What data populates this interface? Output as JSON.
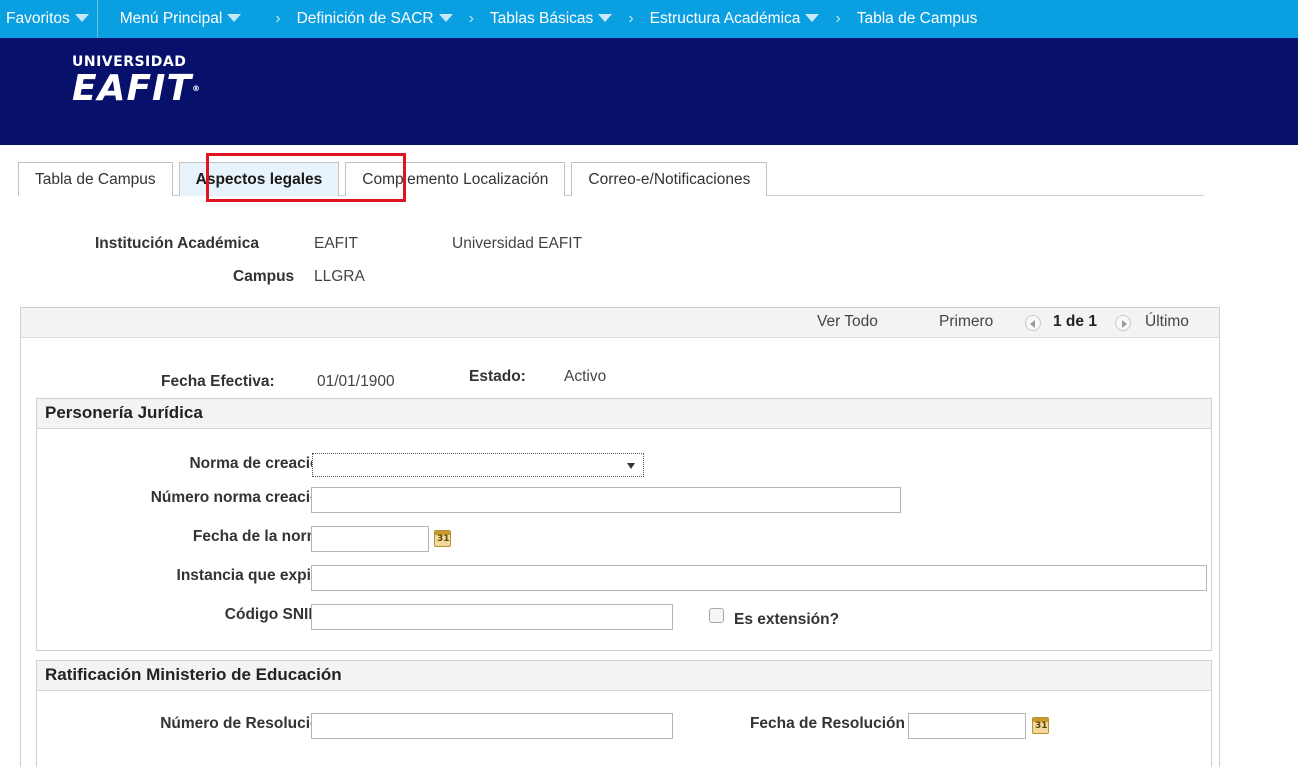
{
  "nav": {
    "favoritos": "Favoritos",
    "menu_principal": "Menú Principal",
    "breadcrumb": [
      "Definición de SACR",
      "Tablas Básicas",
      "Estructura Académica",
      "Tabla de Campus"
    ]
  },
  "banner": {
    "logo_line1": "UNIVERSIDAD",
    "logo_line2": "EAFIT",
    "logo_reg": "®"
  },
  "tabs": [
    {
      "label": "Tabla de Campus",
      "active": false
    },
    {
      "label": "Aspectos legales",
      "active": true
    },
    {
      "label": "Complemento Localización",
      "active": false
    },
    {
      "label": "Correo-e/Notificaciones",
      "active": false
    }
  ],
  "header": {
    "institucion_label": "Institución Académica",
    "institucion_code": "EAFIT",
    "institucion_name": "Universidad EAFIT",
    "campus_label": "Campus",
    "campus_value": "LLGRA"
  },
  "pager": {
    "ver_todo": "Ver Todo",
    "primero": "Primero",
    "count": "1 de 1",
    "ultimo": "Último"
  },
  "record": {
    "fecha_label": "Fecha Efectiva:",
    "fecha_value": "01/01/1900",
    "estado_label": "Estado:",
    "estado_value": "Activo"
  },
  "personeria": {
    "title": "Personería Jurídica",
    "norma_label": "Norma de creación",
    "norma_value": "",
    "numero_label": "Número norma creación",
    "numero_value": "",
    "fecha_label": "Fecha de la norma",
    "fecha_value": "",
    "instancia_label": "Instancia que expide",
    "instancia_value": "",
    "snies_label": "Código SNIES",
    "snies_value": "",
    "extension_label": "Es extensión?"
  },
  "ratificacion": {
    "title": "Ratificación Ministerio de Educación",
    "resolucion_label": "Número de Resolución",
    "resolucion_value": "",
    "fecha_label": "Fecha de Resolución",
    "fecha_value": ""
  },
  "colors": {
    "nav_bg": "#0a9fe0",
    "banner_bg": "#07106b",
    "highlight": "#e0141e"
  },
  "icons": {
    "calendar": "calendar-icon",
    "dropdown": "chevron-down-icon",
    "prev": "previous-arrow-icon",
    "next": "next-arrow-icon"
  }
}
